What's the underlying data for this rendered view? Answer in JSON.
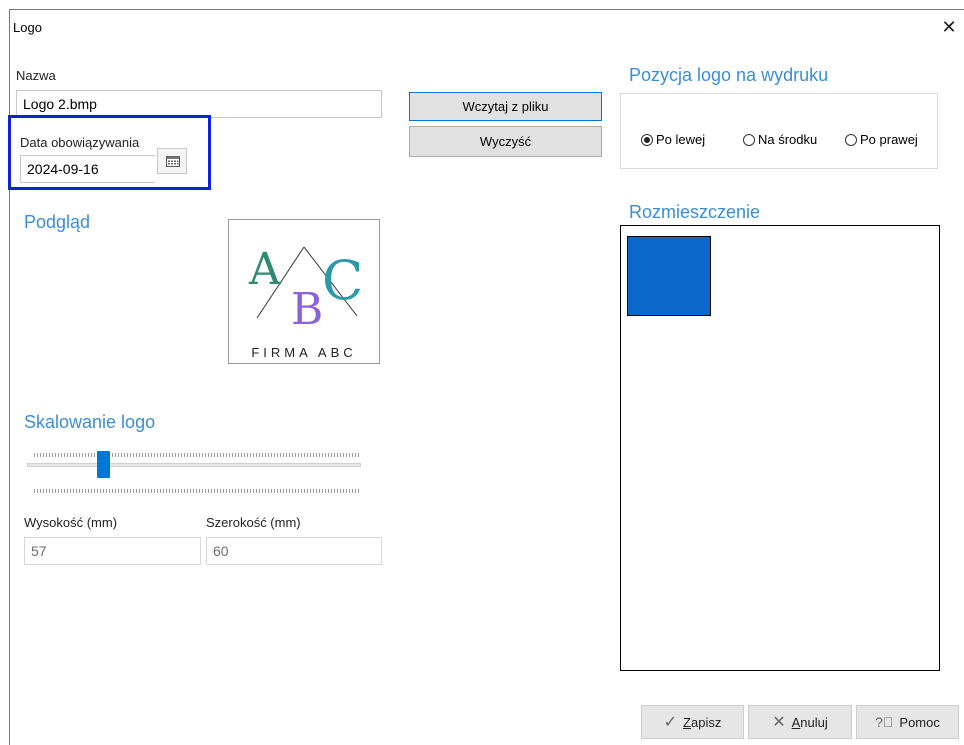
{
  "window": {
    "title": "Logo",
    "close_glyph": "✕"
  },
  "form": {
    "nazwa_label": "Nazwa",
    "nazwa_value": "Logo 2.bmp",
    "data_label": "Data obowiązywania",
    "data_value": "2024-09-16"
  },
  "buttons": {
    "load": "Wczytaj z pliku",
    "clear": "Wyczyść"
  },
  "preview": {
    "section": "Podgląd",
    "logo_text": "FIRMA ABC",
    "letters": [
      "A",
      "B",
      "C"
    ]
  },
  "scaling": {
    "section": "Skalowanie logo",
    "slider_fraction": 0.22,
    "height_label": "Wysokość (mm)",
    "height_value": "57",
    "width_label": "Szerokość (mm)",
    "width_value": "60"
  },
  "position": {
    "section": "Pozycja logo na wydruku",
    "options": [
      "Po lewej",
      "Na środku",
      "Po prawej"
    ],
    "selected": "Po lewej"
  },
  "layout_preview": {
    "section": "Rozmieszczenie"
  },
  "footer": {
    "save": "Zapisz",
    "cancel": "Anuluj",
    "help": "Pomoc"
  },
  "colors": {
    "accent": "#0078d7",
    "section_title": "#3a8ed8",
    "highlight": "#1020e0",
    "logo_block": "#0a68c8"
  }
}
